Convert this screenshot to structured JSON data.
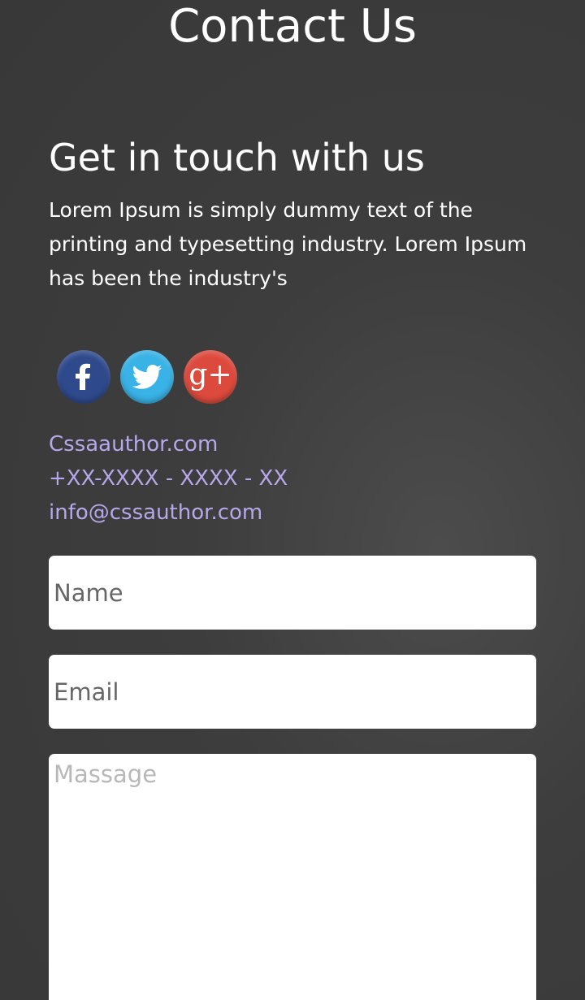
{
  "page": {
    "title": "Contact Us"
  },
  "section": {
    "heading": "Get in touch with us",
    "intro": "Lorem Ipsum is simply dummy text of the printing and typesetting industry. Lorem Ipsum has been the industry's"
  },
  "social": {
    "facebook_icon": "facebook-icon",
    "twitter_icon": "twitter-icon",
    "googleplus_icon": "google-plus-icon",
    "googleplus_glyph": "g+",
    "colors": {
      "facebook": "#2f4a8c",
      "twitter": "#39b2e5",
      "googleplus": "#dc4a3d"
    }
  },
  "contact": {
    "website": "Cssaauthor.com",
    "phone": "+XX-XXXX - XXXX - XX",
    "email": "info@cssauthor.com",
    "link_color": "#b7a8ea"
  },
  "form": {
    "name_placeholder": "Name",
    "email_placeholder": "Email",
    "message_placeholder": "Massage"
  }
}
